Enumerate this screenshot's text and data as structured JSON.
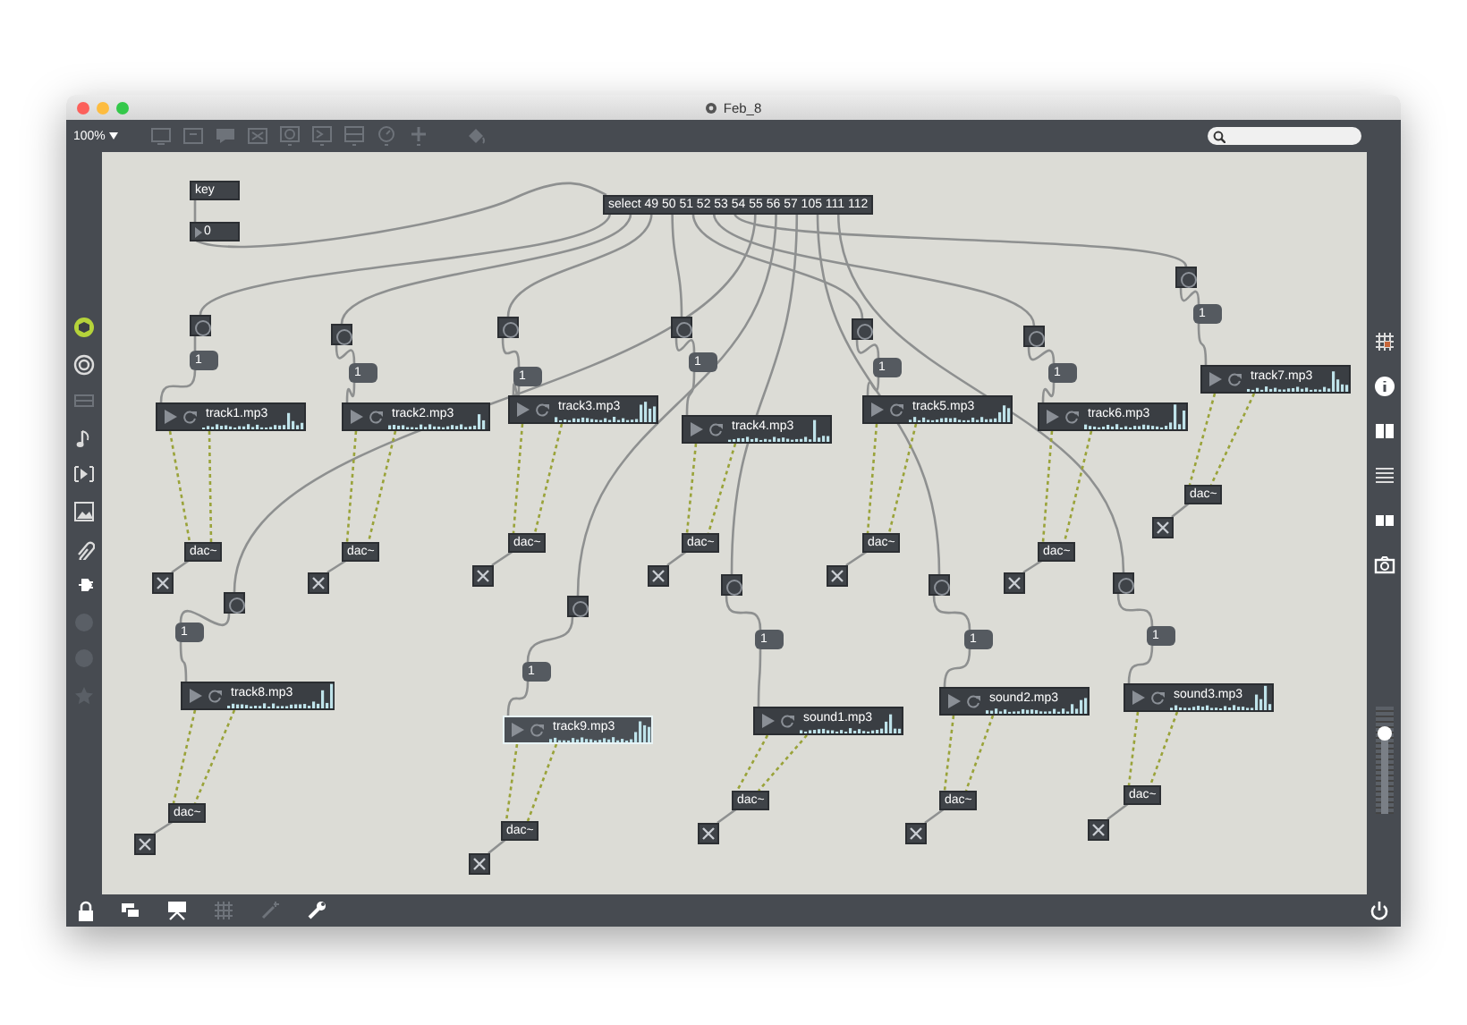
{
  "window": {
    "title": "Feb_8"
  },
  "toolbar": {
    "zoom": "100%"
  },
  "patch": {
    "key": "key",
    "number": "0",
    "select": "select 49 50 51 52 53 54 55 56 57 105 111 112",
    "branches": [
      {
        "message": "1",
        "player": {
          "file": "track1.mp3",
          "selected": false
        },
        "dac": "dac~"
      },
      {
        "message": "1",
        "player": {
          "file": "track2.mp3",
          "selected": false
        },
        "dac": "dac~"
      },
      {
        "message": "1",
        "player": {
          "file": "track3.mp3",
          "selected": false
        },
        "dac": "dac~"
      },
      {
        "message": "1",
        "player": {
          "file": "track4.mp3",
          "selected": false
        },
        "dac": "dac~"
      },
      {
        "message": "1",
        "player": {
          "file": "track5.mp3",
          "selected": false
        },
        "dac": "dac~"
      },
      {
        "message": "1",
        "player": {
          "file": "track6.mp3",
          "selected": false
        },
        "dac": "dac~"
      },
      {
        "message": "1",
        "player": {
          "file": "track7.mp3",
          "selected": false
        },
        "dac": "dac~"
      },
      {
        "message": "1",
        "player": {
          "file": "track8.mp3",
          "selected": false
        },
        "dac": "dac~"
      },
      {
        "message": "1",
        "player": {
          "file": "track9.mp3",
          "selected": true
        },
        "dac": "dac~"
      },
      {
        "message": "1",
        "player": {
          "file": "sound1.mp3",
          "selected": false
        },
        "dac": "dac~"
      },
      {
        "message": "1",
        "player": {
          "file": "sound2.mp3",
          "selected": false
        },
        "dac": "dac~"
      },
      {
        "message": "1",
        "player": {
          "file": "sound3.mp3",
          "selected": false
        },
        "dac": "dac~"
      }
    ]
  },
  "volume": {
    "level": 0.75
  }
}
